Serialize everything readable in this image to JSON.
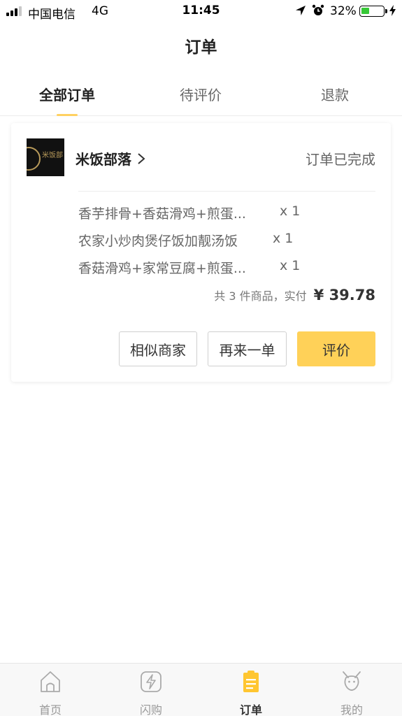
{
  "status_bar": {
    "carrier": "中国电信",
    "network": "4G",
    "time": "11:45",
    "battery": "32%",
    "battery_level": 0.32,
    "icons": [
      "signal-icon",
      "location-icon",
      "alarm-icon",
      "battery-icon",
      "charging-icon"
    ]
  },
  "nav": {
    "title": "订单"
  },
  "tabs": [
    {
      "label": "全部订单",
      "active": true
    },
    {
      "label": "待评价",
      "active": false
    },
    {
      "label": "退款",
      "active": false
    }
  ],
  "order": {
    "shop_name": "米饭部落",
    "logo_text": "米饭部",
    "status": "订单已完成",
    "items": [
      {
        "name": "香芋排骨+香菇滑鸡+煎蛋...",
        "qty": "x 1"
      },
      {
        "name": "农家小炒肉煲仔饭加靓汤饭",
        "qty": "x 1"
      },
      {
        "name": "香菇滑鸡+家常豆腐+煎蛋...",
        "qty": "x 1"
      }
    ],
    "summary_label": "共 3 件商品，实付",
    "total": "¥ 39.78",
    "buttons": {
      "similar": "相似商家",
      "reorder": "再来一单",
      "review": "评价"
    }
  },
  "colors": {
    "accent": "#ffd158",
    "tab_indicator": "#ffd161",
    "battery_fill": "#37c837"
  },
  "tabbar": [
    {
      "label": "首页",
      "icon": "home-icon",
      "active": false
    },
    {
      "label": "闪购",
      "icon": "flash-icon",
      "active": false
    },
    {
      "label": "订单",
      "icon": "orders-icon",
      "active": true
    },
    {
      "label": "我的",
      "icon": "profile-icon",
      "active": false
    }
  ]
}
